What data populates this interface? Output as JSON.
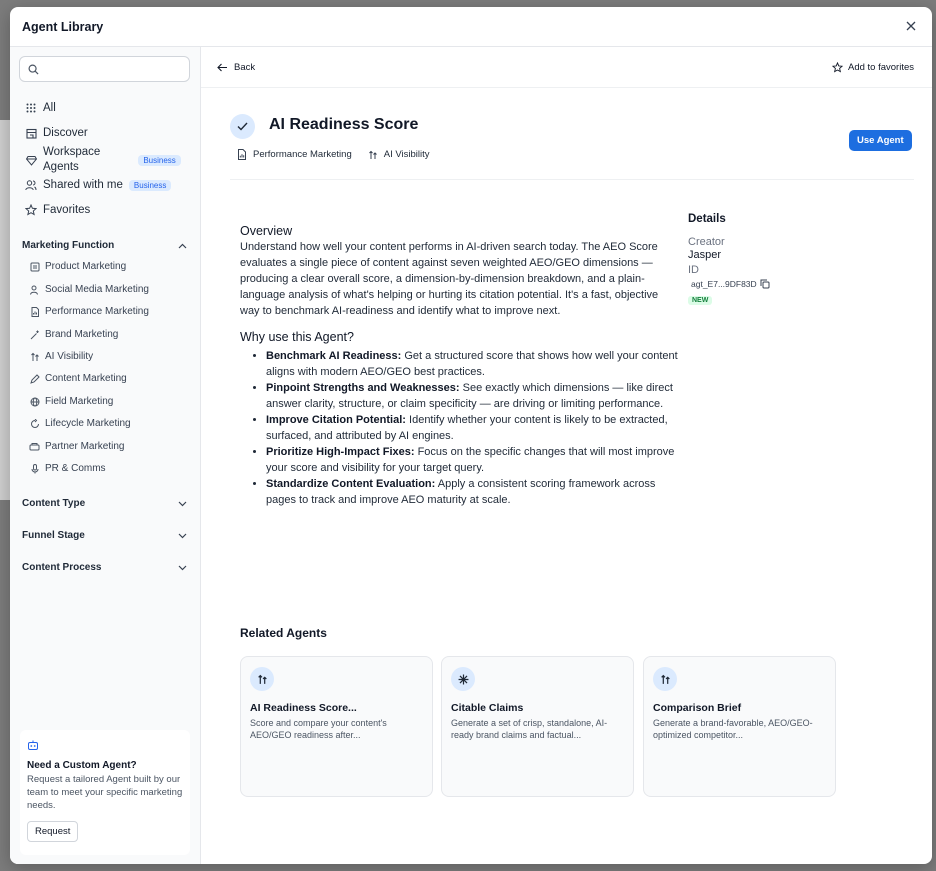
{
  "modal": {
    "title": "Agent Library"
  },
  "sidebar": {
    "search_placeholder": "",
    "nav": [
      {
        "label": "All",
        "icon": "grid-icon"
      },
      {
        "label": "Discover",
        "icon": "store-icon"
      },
      {
        "label": "Workspace Agents",
        "label_line1": "Workspace",
        "label_line2": "Agents",
        "badge": "Business",
        "icon": "diamond-icon"
      },
      {
        "label": "Shared with me",
        "badge": "Business",
        "icon": "users-icon"
      },
      {
        "label": "Favorites",
        "icon": "star-icon"
      }
    ],
    "marketing_function": {
      "title": "Marketing Function",
      "items": [
        "Product Marketing",
        "Social Media Marketing",
        "Performance Marketing",
        "Brand Marketing",
        "AI Visibility",
        "Content Marketing",
        "Field Marketing",
        "Lifecycle Marketing",
        "Partner Marketing",
        "PR & Comms"
      ]
    },
    "sections": [
      "Content Type",
      "Funnel Stage",
      "Content Process"
    ],
    "custom_card": {
      "title": "Need a Custom Agent?",
      "text": "Request a tailored Agent built by our team to meet your specific marketing needs.",
      "button": "Request"
    }
  },
  "topbar": {
    "back": "Back",
    "favorites": "Add to favorites"
  },
  "agent": {
    "title": "AI Readiness Score",
    "tags": [
      "Performance Marketing",
      "AI Visibility"
    ],
    "use_button": "Use Agent",
    "overview_title": "Overview",
    "overview": "Understand how well your content performs in AI-driven search today. The AEO Score evaluates a single piece of content against seven weighted AEO/GEO dimensions — producing a clear overall score, a dimension-by-dimension breakdown, and a plain-language analysis of what's helping or hurting its citation potential. It's a fast, objective way to benchmark AI-readiness and identify what to improve next.",
    "why_title": "Why use this Agent?",
    "benefits": [
      {
        "bold": "Benchmark AI Readiness:",
        "text": " Get a structured score that shows how well your content aligns with modern AEO/GEO best practices."
      },
      {
        "bold": "Pinpoint Strengths and Weaknesses:",
        "text": " See exactly which dimensions — like direct answer clarity, structure, or claim specificity — are driving or limiting performance."
      },
      {
        "bold": "Improve Citation Potential:",
        "text": " Identify whether your content is likely to be extracted, surfaced, and attributed by AI engines."
      },
      {
        "bold": "Prioritize High-Impact Fixes:",
        "text": " Focus on the specific changes that will most improve your score and visibility for your target query."
      },
      {
        "bold": "Standardize Content Evaluation:",
        "text": " Apply a consistent scoring framework across pages to track and improve AEO maturity at scale."
      }
    ]
  },
  "details": {
    "title": "Details",
    "creator_label": "Creator",
    "creator": "Jasper",
    "id_label": "ID",
    "id": "agt_E7...9DF83D",
    "badge": "NEW"
  },
  "related": {
    "title": "Related Agents",
    "cards": [
      {
        "title": "AI Readiness Score...",
        "desc": "Score and compare your content's AEO/GEO readiness after...",
        "icon": "arrows-up-down-icon"
      },
      {
        "title": "Citable Claims",
        "desc": "Generate a set of crisp, standalone, AI-ready brand claims and factual...",
        "icon": "sparkle-icon"
      },
      {
        "title": "Comparison Brief",
        "desc": "Generate a brand-favorable, AEO/GEO-optimized competitor...",
        "icon": "arrows-up-down-icon"
      }
    ]
  }
}
